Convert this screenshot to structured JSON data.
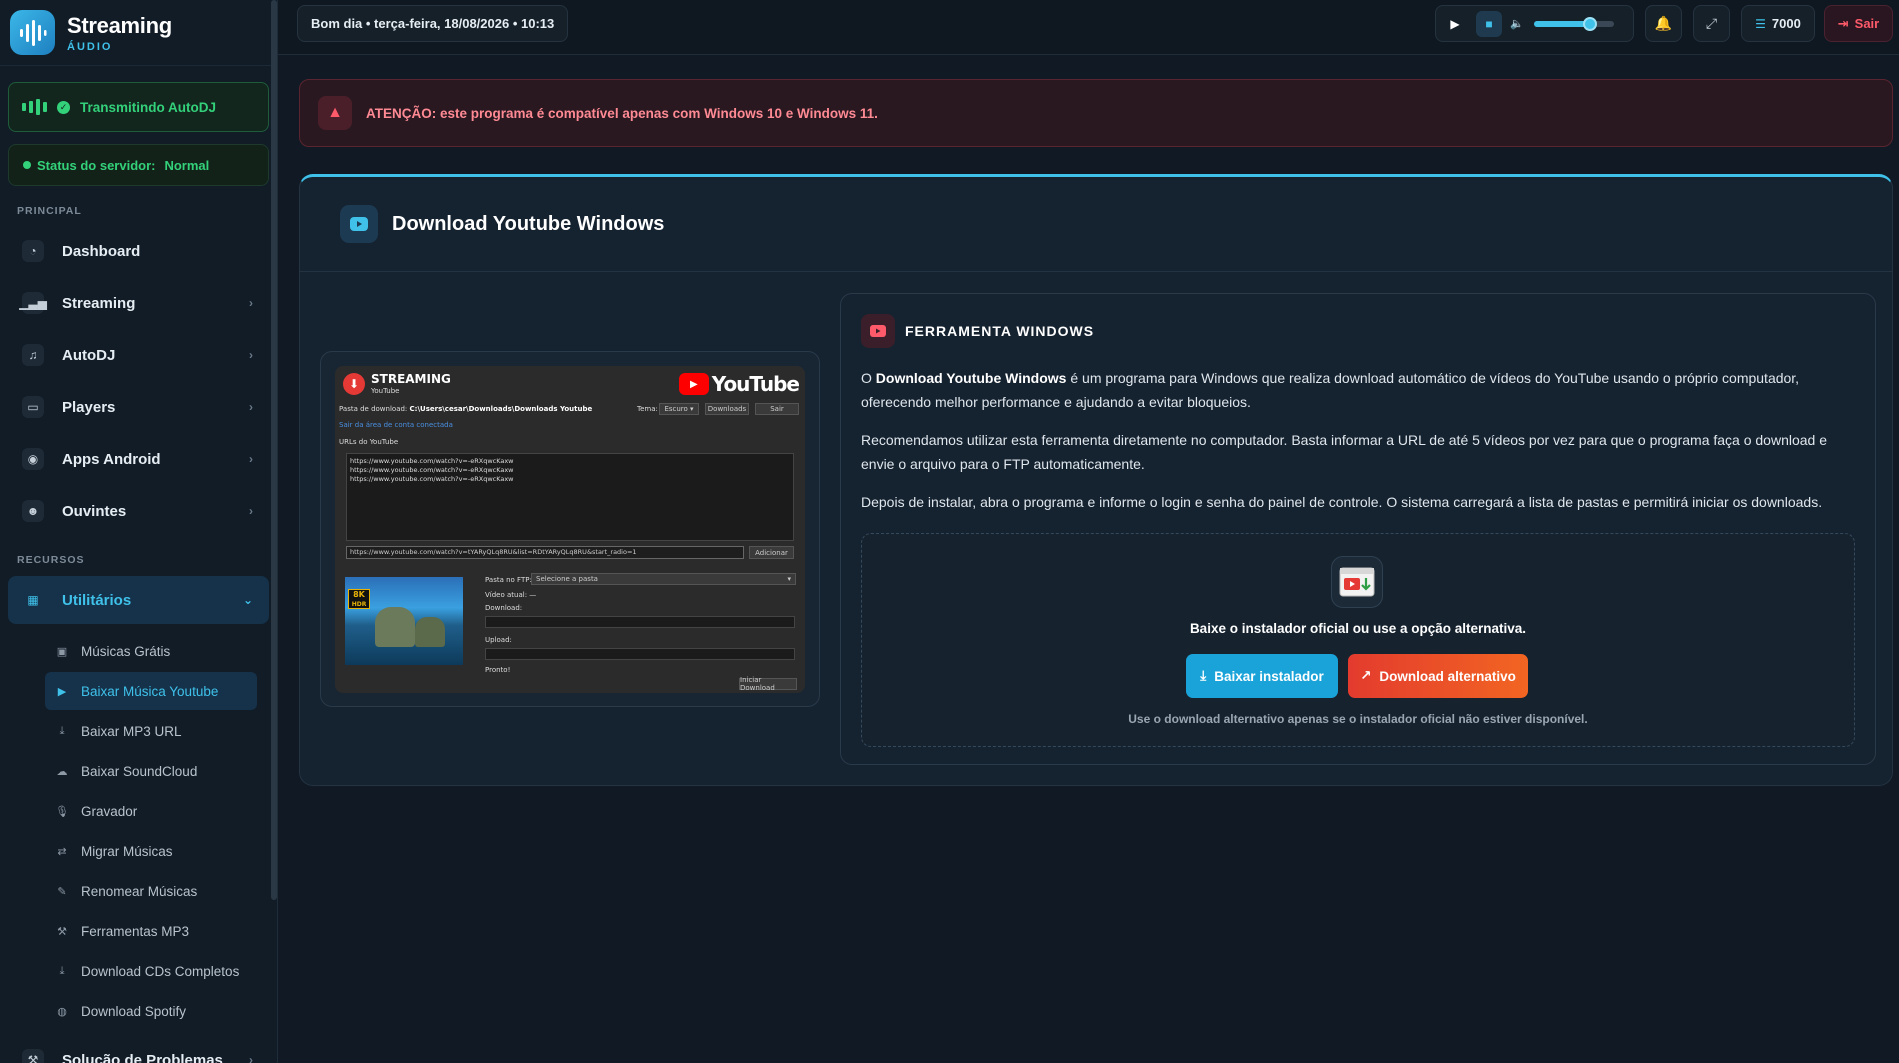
{
  "brand": {
    "name": "Streaming",
    "sub": "ÁUDIO"
  },
  "sidebar": {
    "live_label": "Transmitindo AutoDJ",
    "status_label": "Status do servidor:",
    "status_value": "Normal",
    "section_main": "PRINCIPAL",
    "section_resources": "RECURSOS",
    "items": [
      {
        "label": "Dashboard",
        "icon": "gauge-icon"
      },
      {
        "label": "Streaming",
        "icon": "signal-icon"
      },
      {
        "label": "AutoDJ",
        "icon": "music-note-icon"
      },
      {
        "label": "Players",
        "icon": "monitor-icon"
      },
      {
        "label": "Apps Android",
        "icon": "android-icon"
      },
      {
        "label": "Ouvintes",
        "icon": "users-icon"
      }
    ],
    "utilities": {
      "label": "Utilitários",
      "icon": "grid-icon"
    },
    "sub_items": [
      {
        "label": "Músicas Grátis",
        "icon": "gift-icon"
      },
      {
        "label": "Baixar Música Youtube",
        "icon": "youtube-icon"
      },
      {
        "label": "Baixar MP3 URL",
        "icon": "download-icon"
      },
      {
        "label": "Baixar SoundCloud",
        "icon": "cloud-icon"
      },
      {
        "label": "Gravador",
        "icon": "microphone-icon"
      },
      {
        "label": "Migrar Músicas",
        "icon": "arrows-icon"
      },
      {
        "label": "Renomear Músicas",
        "icon": "pencil-icon"
      },
      {
        "label": "Ferramentas MP3",
        "icon": "wrench-icon"
      },
      {
        "label": "Download CDs Completos",
        "icon": "download-icon"
      },
      {
        "label": "Download Spotify",
        "icon": "spotify-icon"
      }
    ],
    "last_item": "Solução de Problemas"
  },
  "topbar": {
    "greeting": "Bom dia • terça-feira, 18/08/2026 • 10:13",
    "volume": 0.7,
    "credits": "7000",
    "logout": "Sair"
  },
  "alert": {
    "text": "ATENÇÃO: este programa é compatível apenas com Windows 10 e Windows 11."
  },
  "card": {
    "title": "Download Youtube Windows"
  },
  "app_preview": {
    "brand": "STREAMING",
    "brand_sub": "YouTube",
    "yt_word": "YouTube",
    "folder_label": "Pasta de download:",
    "folder_path": "C:\\Users\\cesar\\Downloads\\Downloads Youtube",
    "theme_label": "Tema:",
    "theme_value": "Escuro",
    "btn_downloads": "Downloads",
    "btn_exit": "Sair",
    "link_text": "Sair da área de conta conectada",
    "urls_label": "URLs do YouTube",
    "urls": [
      "https://www.youtube.com/watch?v=-eRXqwcKaxw",
      "https://www.youtube.com/watch?v=-eRXqwcKaxw",
      "https://www.youtube.com/watch?v=-eRXqwcKaxw"
    ],
    "input_url": "https://www.youtube.com/watch?v=tYARyQLq8RU&list=RDtYARyQLq8RU&start_radio=1",
    "btn_add": "Adicionar",
    "ftp_label": "Pasta no FTP:",
    "ftp_value": "Selecione a pasta",
    "video_label": "Vídeo atual: —",
    "download_label": "Download:",
    "upload_label": "Upload:",
    "ready_label": "Pronto!",
    "btn_start": "Iniciar Download",
    "thumb_badge_1": "8K",
    "thumb_badge_2": "HDR"
  },
  "info": {
    "title": "FERRAMENTA WINDOWS",
    "p1_bold": "Download Youtube Windows",
    "p1_pre": "O ",
    "p1_rest": " é um programa para Windows que realiza download automático de vídeos do YouTube usando o próprio computador, oferecendo melhor performance e ajudando a evitar bloqueios.",
    "p2": "Recomendamos utilizar esta ferramenta diretamente no computador. Basta informar a URL de até 5 vídeos por vez para que o programa faça o download e envie o arquivo para o FTP automaticamente.",
    "p3": "Depois de instalar, abra o programa e informe o login e senha do painel de controle. O sistema carregará a lista de pastas e permitirá iniciar os downloads.",
    "lead": "Baixe o instalador oficial ou use a opção alternativa.",
    "btn_main": "Baixar instalador",
    "btn_alt": "Download alternativo",
    "note": "Use o download alternativo apenas se o instalador oficial não estiver disponível."
  },
  "colors": {
    "accent": "#3fc1ea",
    "success": "#33d17a",
    "danger": "#ff5a6a",
    "alt_button": "#e33b2e"
  }
}
